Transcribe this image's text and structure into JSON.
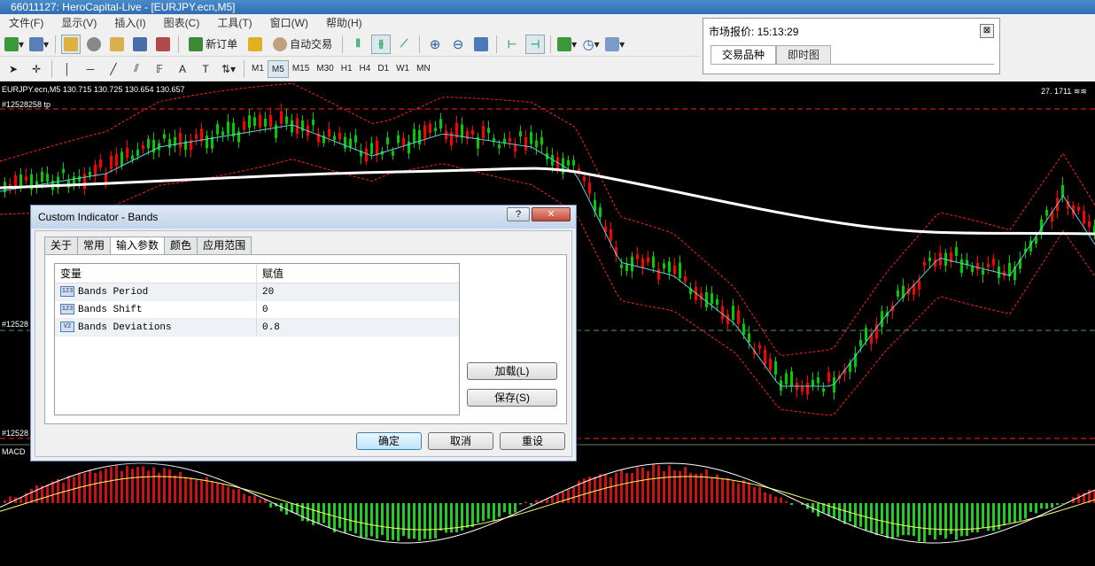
{
  "window": {
    "title": "66011127: HeroCapital-Live - [EURJPY.ecn,M5]"
  },
  "menu": [
    "文件(F)",
    "显示(V)",
    "插入(I)",
    "图表(C)",
    "工具(T)",
    "窗口(W)",
    "帮助(H)"
  ],
  "toolbar1": {
    "new_order": "新订单",
    "auto_trading": "自动交易"
  },
  "timeframes": [
    "M1",
    "M5",
    "M15",
    "M30",
    "H1",
    "H4",
    "D1",
    "W1",
    "MN"
  ],
  "selected_timeframe": "M5",
  "market_watch": {
    "title": "市场报价: 15:13:29",
    "close": "⊠",
    "tabs": [
      "交易品种",
      "即时图"
    ]
  },
  "chart": {
    "symbol_info": "EURJPY.ecn,M5  130.715 130.725 130.654 130.657",
    "order_label": "#12528258 tp",
    "level_label_1": "#12528",
    "level_label_2": "#12528",
    "macd_label": "MACD",
    "top_right": "27. 1711 ≋≋",
    "colors": {
      "bull": "#ff0000",
      "bear": "#00cc00",
      "ma": "#ffffff",
      "bands": "#ff2020",
      "signal": "#ffff66"
    }
  },
  "dialog": {
    "title": "Custom Indicator - Bands",
    "help": "?",
    "close": "✕",
    "tabs": [
      "关于",
      "常用",
      "输入参数",
      "颜色",
      "应用范围"
    ],
    "active_tab": "输入参数",
    "columns": [
      "变量",
      "赋值"
    ],
    "rows": [
      {
        "type": "123",
        "name": "Bands Period",
        "value": "20"
      },
      {
        "type": "123",
        "name": "Bands Shift",
        "value": "0"
      },
      {
        "type": "V2",
        "name": "Bands Deviations",
        "value": "0.8"
      }
    ],
    "load_button": "加载(L)",
    "save_button": "保存(S)",
    "ok_button": "确定",
    "cancel_button": "取消",
    "reset_button": "重设"
  }
}
